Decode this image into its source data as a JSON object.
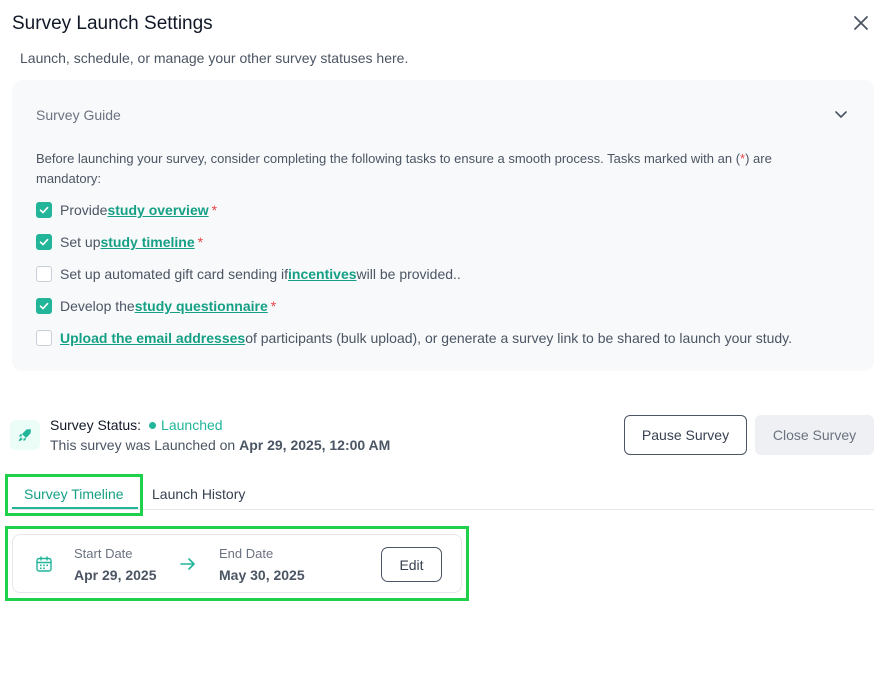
{
  "dialog": {
    "title": "Survey Launch Settings",
    "subtitle": "Launch, schedule, or manage your other survey statuses here."
  },
  "guide": {
    "title": "Survey Guide",
    "intro_before": "Before launching your survey, consider completing the following tasks to ensure a smooth process. Tasks marked with an (",
    "intro_star": "*",
    "intro_after": ") are mandatory:",
    "tasks": [
      {
        "checked": true,
        "pre": "Provide ",
        "link": "study overview",
        "post": "",
        "required": "*"
      },
      {
        "checked": true,
        "pre": "Set up ",
        "link": "study timeline",
        "post": "",
        "required": "*"
      },
      {
        "checked": false,
        "pre": "Set up automated gift card sending if ",
        "link": "incentives",
        "post": " will be provided..",
        "required": ""
      },
      {
        "checked": true,
        "pre": "Develop the ",
        "link": "study questionnaire",
        "post": "",
        "required": "*"
      },
      {
        "checked": false,
        "pre": "",
        "link": "Upload the email addresses",
        "post": " of participants (bulk upload), or generate a survey link to be shared to launch your study.",
        "required": ""
      }
    ]
  },
  "status": {
    "label": "Survey Status:",
    "value": "Launched",
    "desc_prefix": "This survey was Launched on ",
    "desc_date": "Apr 29, 2025, 12:00 AM",
    "color": "#22b59a"
  },
  "actions": {
    "pause": "Pause Survey",
    "close": "Close Survey"
  },
  "tabs": {
    "timeline": "Survey Timeline",
    "history": "Launch History"
  },
  "timeline": {
    "start_label": "Start Date",
    "start_value": "Apr 29, 2025",
    "end_label": "End Date",
    "end_value": "May 30, 2025",
    "edit": "Edit"
  },
  "icons": {
    "close": "close-icon",
    "chevron": "chevron-down-icon",
    "check": "check-icon",
    "rocket": "rocket-icon",
    "calendar": "calendar-icon",
    "arrow": "arrow-right-icon"
  }
}
